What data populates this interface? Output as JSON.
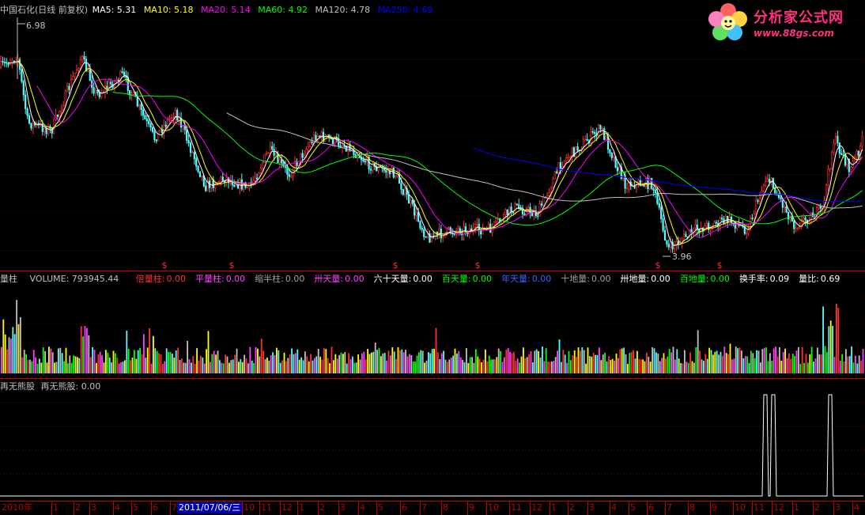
{
  "main_header": {
    "title": "中国石化(日线 前复权)",
    "ma5": "MA5: 5.31",
    "ma10": "MA10: 5.18",
    "ma20": "MA20: 5.14",
    "ma60": "MA60: 4.92",
    "ma120": "MA120: 4.78",
    "ma250": "MA250: 4.69"
  },
  "colors": {
    "ma5": "#ffffff",
    "ma10": "#ffff00",
    "ma20": "#ff00ff",
    "ma60": "#00ff00",
    "ma120": "#c0c0c0",
    "ma250": "#0000ff",
    "up": "#ff3030",
    "down": "#54fcfc",
    "axis": "#c00000"
  },
  "price_labels": {
    "high": "6.98",
    "low": "3.96"
  },
  "signal_mark": "$",
  "volume_header": {
    "name": "量柱",
    "volume": "VOLUME: 793945.44",
    "items": [
      {
        "label": "倍量柱:",
        "value": "0.00",
        "color": "#ff3030"
      },
      {
        "label": "平量柱:",
        "value": "0.00",
        "color": "#ff40ff"
      },
      {
        "label": "缩半柱:",
        "value": "0.00",
        "color": "#a0a0a0"
      },
      {
        "label": "卅天量:",
        "value": "0.00",
        "color": "#ff40ff"
      },
      {
        "label": "六十天量:",
        "value": "0.00",
        "color": "#ffffff"
      },
      {
        "label": "百天量:",
        "value": "0.00",
        "color": "#00ff00"
      },
      {
        "label": "年天量:",
        "value": "0.00",
        "color": "#4060ff"
      },
      {
        "label": "十地量:",
        "value": "0.00",
        "color": "#a0a0a0"
      },
      {
        "label": "卅地量:",
        "value": "0.00",
        "color": "#ffffff"
      },
      {
        "label": "百地量:",
        "value": "0.00",
        "color": "#00ff00"
      },
      {
        "label": "换手率:",
        "value": "0.09",
        "color": "#ffffff"
      },
      {
        "label": "量比:",
        "value": "0.69",
        "color": "#ffffff"
      }
    ]
  },
  "indicator_header": {
    "name": "再无熊股",
    "line": "再无熊股: 0.00"
  },
  "time_axis": {
    "year_label": "2010年",
    "cursor_date": "2011/07/06/三",
    "ticks": [
      "1",
      "2",
      "3",
      "4",
      "5",
      "6",
      "7",
      "10",
      "11",
      "12",
      "1",
      "2",
      "3",
      "4",
      "5",
      "6",
      "7",
      "8",
      "9",
      "10",
      "11",
      "12",
      "1",
      "2",
      "3",
      "4",
      "5",
      "6",
      "7",
      "8",
      "9",
      "10",
      "11",
      "12",
      "1",
      "2",
      "3",
      "4"
    ]
  },
  "logo": {
    "text": "分析家公式网",
    "url": "www.88gs.com"
  }
}
